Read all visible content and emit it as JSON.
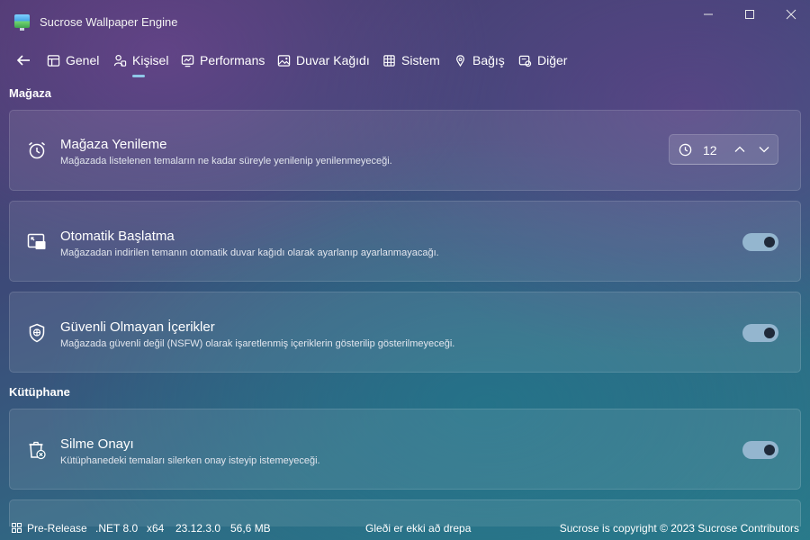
{
  "window": {
    "title": "Sucrose Wallpaper Engine"
  },
  "nav": {
    "tabs": [
      {
        "label": "Genel",
        "icon": "general-icon"
      },
      {
        "label": "Kişisel",
        "icon": "personal-icon",
        "active": true
      },
      {
        "label": "Performans",
        "icon": "performance-icon"
      },
      {
        "label": "Duvar Kağıdı",
        "icon": "wallpaper-icon"
      },
      {
        "label": "Sistem",
        "icon": "system-icon"
      },
      {
        "label": "Bağış",
        "icon": "donate-icon"
      },
      {
        "label": "Diğer",
        "icon": "other-icon"
      }
    ]
  },
  "sections": {
    "store": {
      "title": "Mağaza",
      "refresh": {
        "title": "Mağaza Yenileme",
        "description": "Mağazada listelenen temaların ne kadar süreyle yenilenip yenilenmeyeceği.",
        "value": "12"
      },
      "autostart": {
        "title": "Otomatik Başlatma",
        "description": "Mağazadan indirilen temanın otomatik duvar kağıdı olarak ayarlanıp ayarlanmayacağı.",
        "enabled": true
      },
      "unsafe": {
        "title": "Güvenli Olmayan İçerikler",
        "description": "Mağazada güvenli değil (NSFW) olarak işaretlenmiş içeriklerin gösterilip gösterilmeyeceği.",
        "enabled": true
      }
    },
    "library": {
      "title": "Kütüphane",
      "delete_confirm": {
        "title": "Silme Onayı",
        "description": "Kütüphanedeki temaları silerken onay isteyip istemeyeceği.",
        "enabled": true
      }
    }
  },
  "status": {
    "channel": "Pre-Release",
    "framework": ".NET 8.0",
    "arch": "x64",
    "version": "23.12.3.0",
    "memory": "56,6 MB",
    "message": "Gleði er ekki að drepa",
    "copyright": "Sucrose is copyright © 2023 Sucrose Contributors"
  },
  "colors": {
    "accent": "#8fc8e8",
    "toggle_track": "#94b6cf"
  }
}
